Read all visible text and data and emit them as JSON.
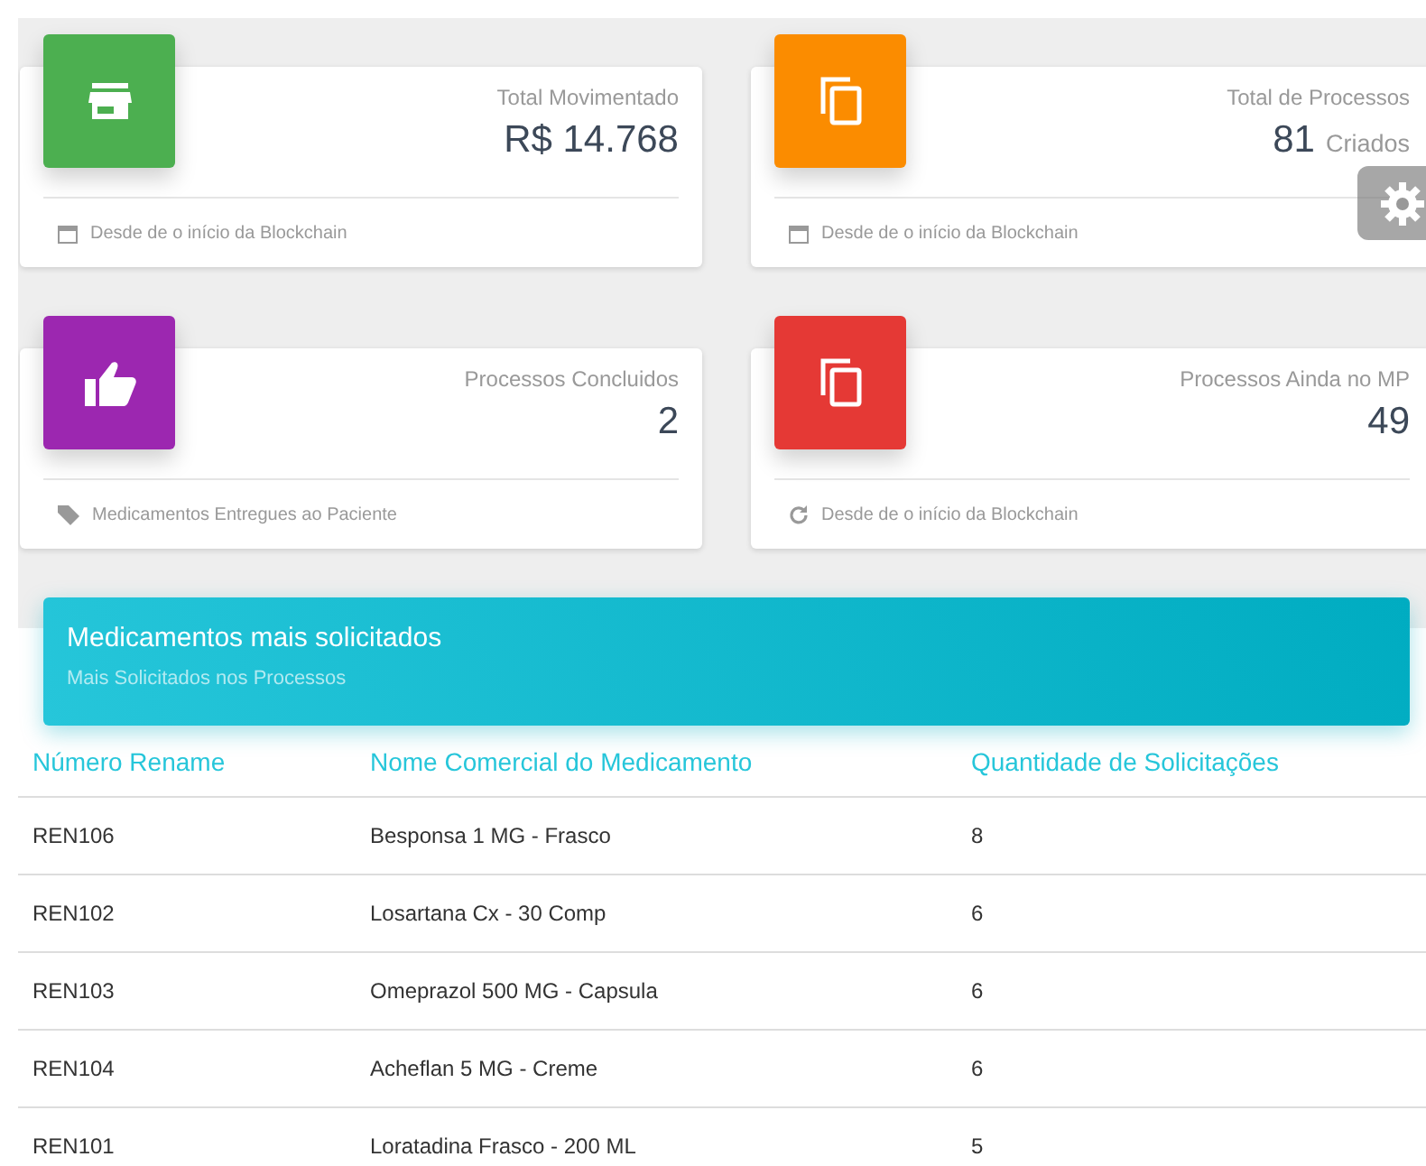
{
  "stat_cards": [
    {
      "kind": "store",
      "color": "#4caf50",
      "title": "Total Movimentado",
      "value": "R$ 14.768",
      "footer": {
        "kind": "calendar",
        "text": "Desde de o início da Blockchain"
      }
    },
    {
      "kind": "copy",
      "color": "#fb8c00",
      "title": "Total de Processos",
      "value": "81",
      "unit": "Criados",
      "footer": {
        "kind": "calendar",
        "text": "Desde de o início da Blockchain"
      }
    },
    {
      "kind": "thumb",
      "color": "#9c27b0",
      "title": "Processos Concluidos",
      "value": "2",
      "footer": {
        "kind": "tag",
        "text": "Medicamentos Entregues ao Paciente"
      }
    },
    {
      "kind": "copy",
      "color": "#e53935",
      "title": "Processos Ainda no MP",
      "value": "49",
      "footer": {
        "kind": "refresh",
        "text": "Desde de o início da Blockchain"
      }
    }
  ],
  "table": {
    "title": "Medicamentos mais solicitados",
    "subtitle": "Mais Solicitados nos Processos",
    "columns": [
      "Número Rename",
      "Nome Comercial do Medicamento",
      "Quantidade de Solicitações"
    ],
    "rows": [
      [
        "REN106",
        "Besponsa 1 MG - Frasco",
        "8"
      ],
      [
        "REN102",
        "Losartana Cx - 30 Comp",
        "6"
      ],
      [
        "REN103",
        "Omeprazol 500 MG - Capsula",
        "6"
      ],
      [
        "REN104",
        "Acheflan 5 MG - Creme",
        "6"
      ],
      [
        "REN101",
        "Loratadina Frasco - 200 ML",
        "5"
      ]
    ]
  }
}
